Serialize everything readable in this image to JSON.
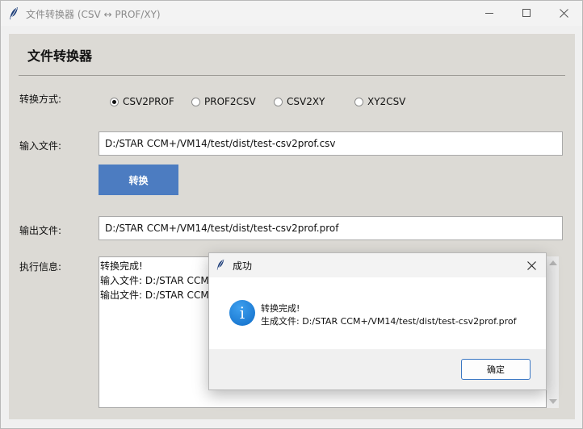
{
  "window": {
    "title": "文件转换器 (CSV ↔ PROF/XY)",
    "controls": [
      "minimize",
      "maximize",
      "close"
    ]
  },
  "main": {
    "heading": "文件转换器",
    "mode_label": "转换方式:",
    "modes": [
      {
        "label": "CSV2PROF",
        "selected": true
      },
      {
        "label": "PROF2CSV",
        "selected": false
      },
      {
        "label": "CSV2XY",
        "selected": false
      },
      {
        "label": "XY2CSV",
        "selected": false
      }
    ],
    "input_label": "输入文件:",
    "input_value": "D:/STAR CCM+/VM14/test/dist/test-csv2prof.csv",
    "convert_label": "转换",
    "output_label": "输出文件:",
    "output_value": "D:/STAR CCM+/VM14/test/dist/test-csv2prof.prof",
    "log_label": "执行信息:",
    "log_lines": [
      "转换完成!",
      "输入文件: D:/STAR CCM",
      "输出文件: D:/STAR CCM"
    ]
  },
  "dialog": {
    "title": "成功",
    "message_line1": "转换完成!",
    "message_line2": "生成文件: D:/STAR CCM+/VM14/test/dist/test-csv2prof.prof",
    "ok_label": "确定",
    "icon": "info-icon"
  },
  "colors": {
    "accent": "#4c7cc1",
    "info": "#1677d2",
    "background": "#dcdad5"
  }
}
